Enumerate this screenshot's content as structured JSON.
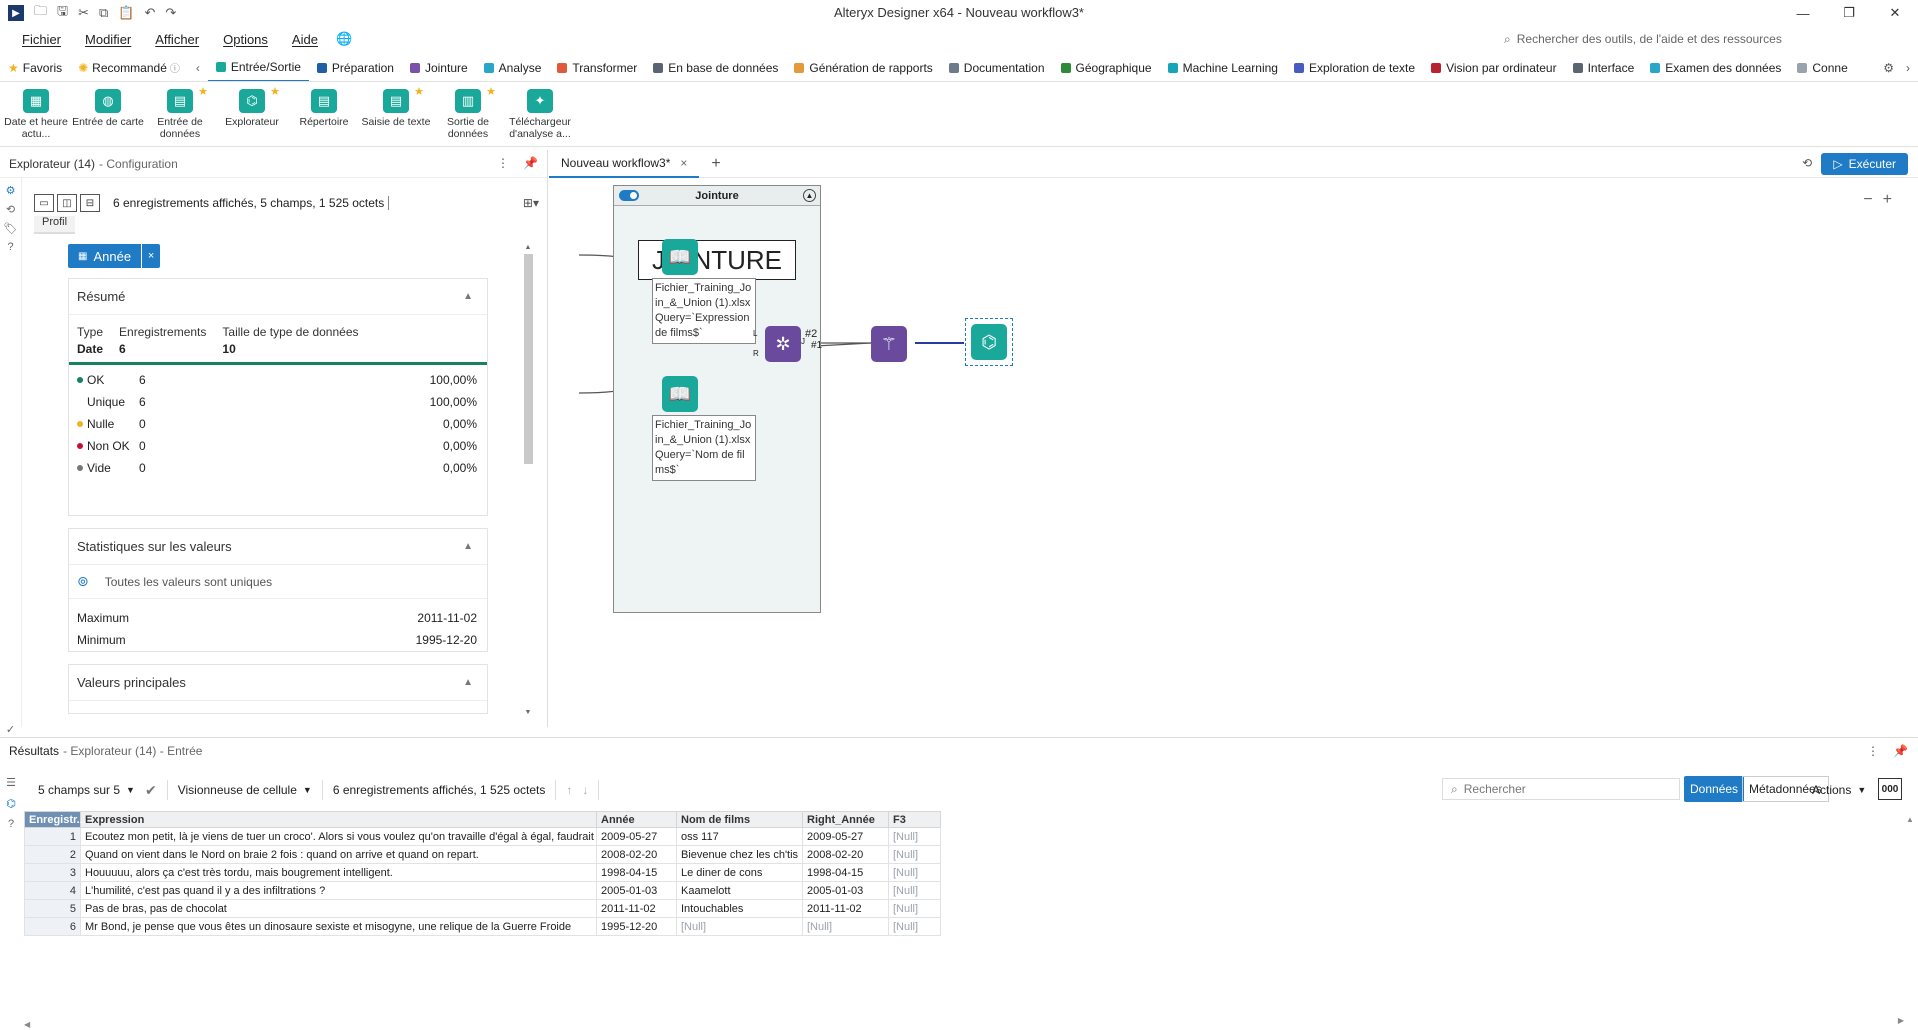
{
  "window": {
    "title": "Alteryx Designer x64 - Nouveau workflow3*",
    "controls": [
      "—",
      "❐",
      "✕"
    ]
  },
  "menu": {
    "items": [
      "Fichier",
      "Modifier",
      "Afficher",
      "Options",
      "Aide"
    ],
    "search_placeholder": "Rechercher des outils, de l'aide et des ressources"
  },
  "categories": {
    "favorites": "Favoris",
    "recommended": "Recommandé",
    "tabs": [
      {
        "label": "Entrée/Sortie",
        "color": "#1aa89a",
        "active": true
      },
      {
        "label": "Préparation",
        "color": "#1f5fa8",
        "active": false
      },
      {
        "label": "Jointure",
        "color": "#7b52a8",
        "active": false
      },
      {
        "label": "Analyse",
        "color": "#2aa6c8",
        "active": false
      },
      {
        "label": "Transformer",
        "color": "#e0573a",
        "active": false
      },
      {
        "label": "En base de données",
        "color": "#5b6470",
        "active": false
      },
      {
        "label": "Génération de rapports",
        "color": "#e39a3b",
        "active": false
      },
      {
        "label": "Documentation",
        "color": "#6b7b8c",
        "active": false
      },
      {
        "label": "Géographique",
        "color": "#2e8b3a",
        "active": false
      },
      {
        "label": "Machine Learning",
        "color": "#16a5b8",
        "active": false
      },
      {
        "label": "Exploration de texte",
        "color": "#4a5bbf",
        "active": false
      },
      {
        "label": "Vision par ordinateur",
        "color": "#b8232f",
        "active": false
      },
      {
        "label": "Interface",
        "color": "#5b6470",
        "active": false
      },
      {
        "label": "Examen des données",
        "color": "#2aa6c8",
        "active": false
      },
      {
        "label": "Conne",
        "color": "#9aa3ad",
        "active": false
      }
    ]
  },
  "palette": {
    "tools": [
      {
        "label": "Date et heure actu...",
        "icon": "calendar-icon",
        "star": false
      },
      {
        "label": "Entrée de carte",
        "icon": "globe-icon",
        "star": false
      },
      {
        "label": "Entrée de données",
        "icon": "book-icon",
        "star": true
      },
      {
        "label": "Explorateur",
        "icon": "binoculars-icon",
        "star": true
      },
      {
        "label": "Répertoire",
        "icon": "book-icon",
        "star": false
      },
      {
        "label": "Saisie de texte",
        "icon": "book-icon",
        "star": true
      },
      {
        "label": "Sortie de données",
        "icon": "book-out-icon",
        "star": true
      },
      {
        "label": "Téléchargeur d'analyse a...",
        "icon": "bulb-icon",
        "star": false
      }
    ]
  },
  "config_panel": {
    "title": "Explorateur (14)",
    "subtitle": "- Configuration",
    "summary": "6 enregistrements affichés, 5 champs, 1 525 octets",
    "profile_tab": "Profil",
    "chip": "Année",
    "resume": {
      "title": "Résumé",
      "type_label": "Type",
      "type_value": "Date",
      "records_label": "Enregistrements",
      "records_value": "6",
      "size_label": "Taille de type de données",
      "size_value": "10",
      "rows": [
        {
          "name": "OK",
          "count": "6",
          "pct": "100,00%",
          "color": "#17825f"
        },
        {
          "name": "Unique",
          "count": "6",
          "pct": "100,00%",
          "color": ""
        },
        {
          "name": "Nulle",
          "count": "0",
          "pct": "0,00%",
          "color": "#f2b21b"
        },
        {
          "name": "Non OK",
          "count": "0",
          "pct": "0,00%",
          "color": "#c8102e"
        },
        {
          "name": "Vide",
          "count": "0",
          "pct": "0,00%",
          "color": "#777777"
        }
      ]
    },
    "stats": {
      "title": "Statistiques sur les valeurs",
      "unique_msg": "Toutes les valeurs sont uniques",
      "max_label": "Maximum",
      "max_value": "2011-11-02",
      "min_label": "Minimum",
      "min_value": "1995-12-20"
    },
    "top_values": {
      "title": "Valeurs principales"
    }
  },
  "canvas": {
    "tab_label": "Nouveau workflow3*",
    "run_label": "Exécuter",
    "container_title": "Jointure",
    "comment": "JOINTURE",
    "annotation1": "Fichier_Training_Join_&_Union (1).xlsx Query=`Expression de films$`",
    "annotation2": "Fichier_Training_Join_&_Union (1).xlsx Query=`Nom de films$`",
    "port_L": "L",
    "port_R": "R",
    "port_J": "J",
    "conn_2": "#2",
    "conn_1": "#1"
  },
  "results": {
    "title": "Résultats",
    "subtitle": "- Explorateur (14) - Entrée",
    "fields": "5 champs sur 5",
    "viewer": "Visionneuse de cellule",
    "summary": "6 enregistrements affichés, 1 525 octets",
    "search_placeholder": "Rechercher",
    "btn_data": "Données",
    "btn_meta": "Métadonnées",
    "btn_actions": "Actions",
    "btn_000": "000",
    "columns": [
      "Enregistr...",
      "Expression",
      "Année",
      "Nom de films",
      "Right_Année",
      "F3"
    ],
    "rows": [
      [
        "1",
        "Ecoutez mon petit, là je viens de tuer un croco'. Alors si vous voulez qu'on travaille d'égal à égal, faudrait vous y mettre.",
        "2009-05-27",
        "oss 117",
        "2009-05-27",
        "[Null]"
      ],
      [
        "2",
        "Quand on vient dans le Nord on braie 2 fois : quand on arrive et quand on repart.",
        "2008-02-20",
        "Bievenue chez les ch'tis",
        "2008-02-20",
        "[Null]"
      ],
      [
        "3",
        "Houuuuu, alors ça c'est très tordu, mais bougrement intelligent.",
        "1998-04-15",
        "Le diner de cons",
        "1998-04-15",
        "[Null]"
      ],
      [
        "4",
        " L'humilité, c'est pas quand il y a des infiltrations ?",
        "2005-01-03",
        "Kaamelott",
        "2005-01-03",
        "[Null]"
      ],
      [
        "5",
        "Pas de bras, pas de chocolat",
        "2011-11-02",
        "Intouchables",
        "2011-11-02",
        "[Null]"
      ],
      [
        "6",
        "Mr Bond, je pense que vous êtes un dinosaure sexiste et misogyne, une relique de la Guerre Froide",
        "1995-12-20",
        "[Null]",
        "[Null]",
        "[Null]"
      ]
    ]
  }
}
